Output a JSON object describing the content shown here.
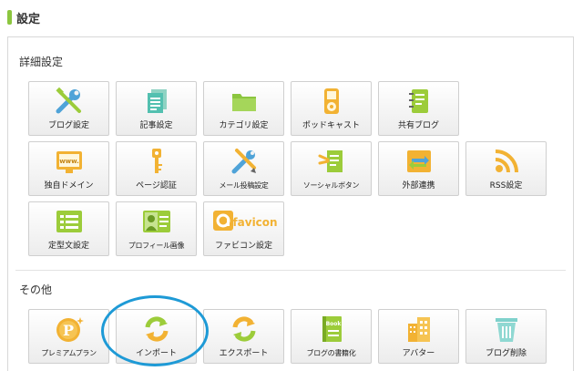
{
  "header": {
    "title": "設定"
  },
  "sections": {
    "advanced": {
      "title": "詳細設定",
      "items": [
        {
          "label": "ブログ設定",
          "icon": "tools-icon"
        },
        {
          "label": "記事設定",
          "icon": "document-icon"
        },
        {
          "label": "カテゴリ設定",
          "icon": "folder-icon"
        },
        {
          "label": "ポッドキャスト",
          "icon": "music-player-icon"
        },
        {
          "label": "共有ブログ",
          "icon": "notebook-icon"
        },
        {
          "label": "独自ドメイン",
          "icon": "domain-screen-icon",
          "icon_text": "www."
        },
        {
          "label": "ページ認証",
          "icon": "key-icon"
        },
        {
          "label": "メール投稿設定",
          "icon": "pencil-wrench-icon"
        },
        {
          "label": "ソーシャルボタン",
          "icon": "share-icon"
        },
        {
          "label": "外部連携",
          "icon": "sync-icon"
        },
        {
          "label": "RSS設定",
          "icon": "rss-icon"
        },
        {
          "label": "定型文設定",
          "icon": "text-template-icon"
        },
        {
          "label": "プロフィール画像",
          "icon": "profile-card-icon"
        },
        {
          "label": "ファビコン設定",
          "icon": "favicon-icon",
          "icon_text": "favicon"
        }
      ]
    },
    "other": {
      "title": "その他",
      "items": [
        {
          "label": "プレミアムプラン",
          "icon": "premium-coin-icon",
          "icon_text": "P"
        },
        {
          "label": "インポート",
          "icon": "import-icon"
        },
        {
          "label": "エクスポート",
          "icon": "export-icon"
        },
        {
          "label": "ブログの書籍化",
          "icon": "book-icon",
          "icon_text": "Book"
        },
        {
          "label": "アバター",
          "icon": "building-icon"
        },
        {
          "label": "ブログ削除",
          "icon": "trash-icon"
        }
      ]
    }
  },
  "colors": {
    "accent": "#8cc63f",
    "highlight_circle": "#1e9ad6"
  }
}
